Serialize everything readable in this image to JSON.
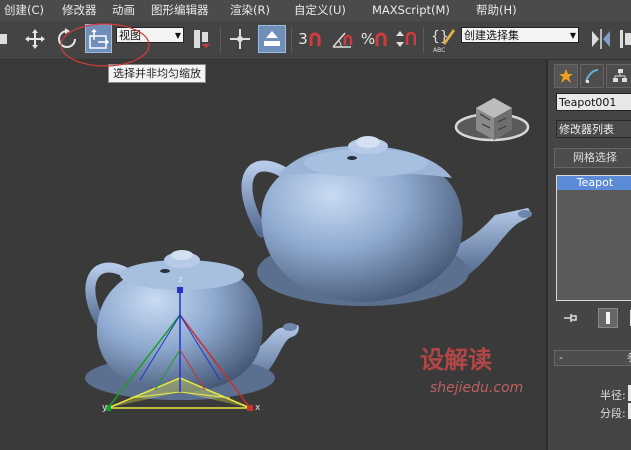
{
  "menu": {
    "items": [
      "创建(C)",
      "修改器",
      "动画",
      "图形编辑器",
      "渲染(R)",
      "自定义(U)",
      "MAXScript(M)",
      "帮助(H)"
    ]
  },
  "toolbar": {
    "view_combo": "视图",
    "snap_number": "3",
    "percent_label": "%",
    "selection_set_combo": "创建选择集",
    "tooltip": "选择并非均匀缩放"
  },
  "viewport": {
    "axis_x": "x",
    "axis_y": "y",
    "axis_z": "z"
  },
  "watermark": {
    "brand": "设解读",
    "url": "shejiedu.com"
  },
  "panel": {
    "object_name": "Teapot001",
    "modifier_list": "修改器列表",
    "mesh_select": "网格选择",
    "stack_item": "Teapot",
    "rollout_minus": "-",
    "rollout_title": "参",
    "radius_label": "半径:",
    "segments_label": "分段:"
  },
  "colors": {
    "menubar_bg": "#4b4b4b",
    "viewport_bg": "#3a3a3a",
    "teapot": "#8fa9cf",
    "selected_stack": "#5b8bd6",
    "highlight_ring": "#d23b3b"
  }
}
